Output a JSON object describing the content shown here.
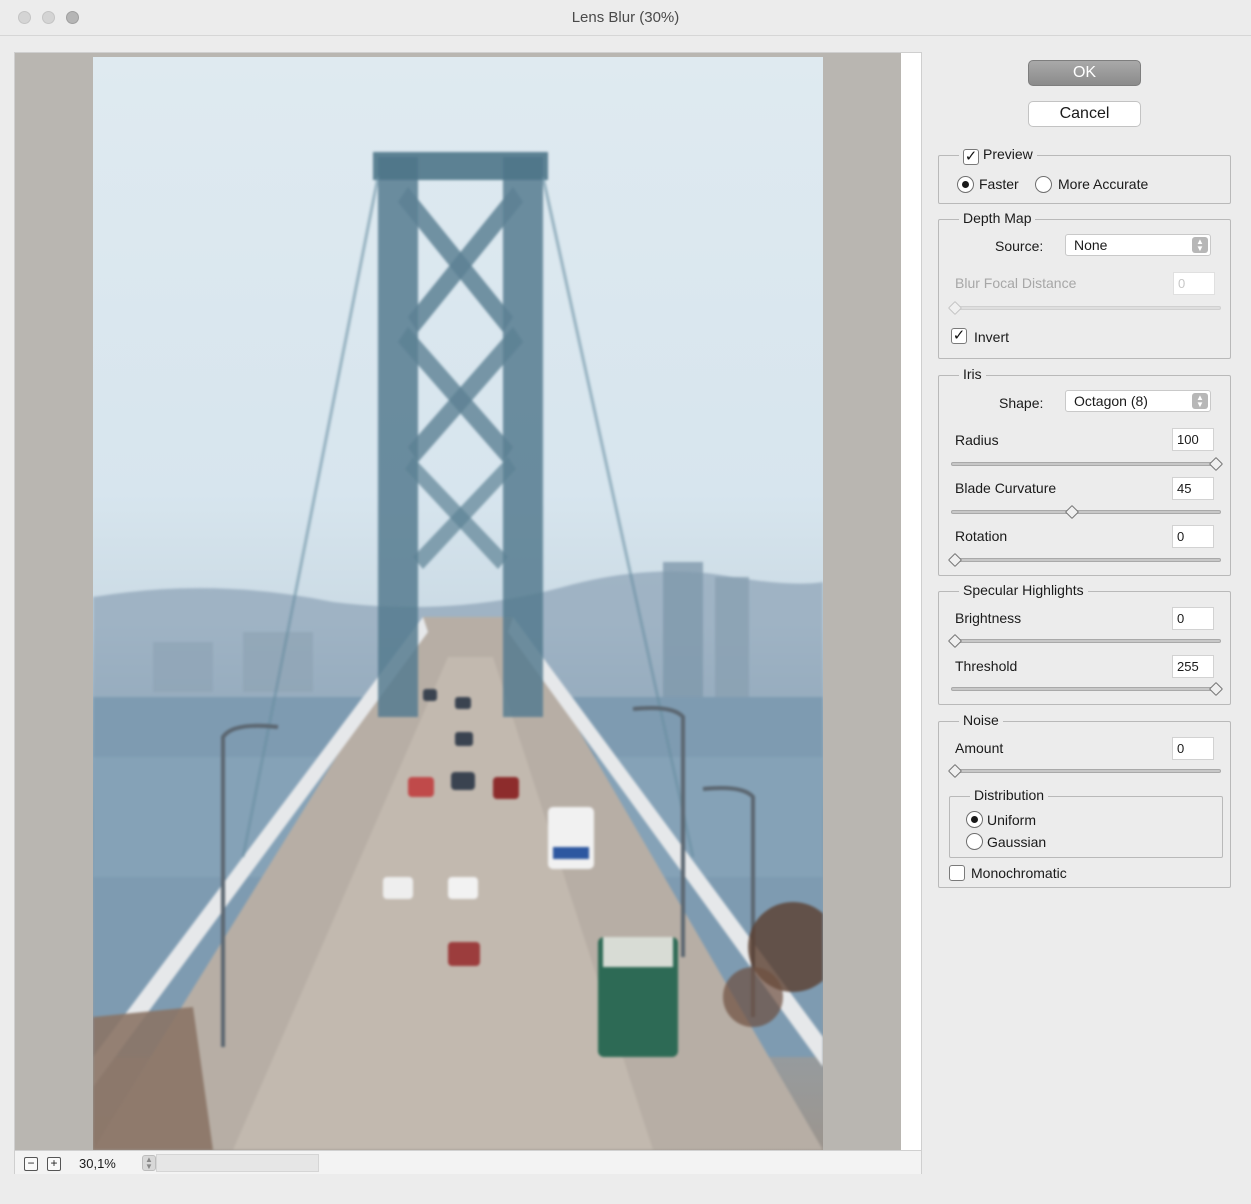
{
  "window": {
    "title": "Lens Blur (30%)"
  },
  "preview": {
    "zoom_value": "30,1%",
    "zoom_out_symbol": "−",
    "zoom_in_symbol": "+"
  },
  "buttons": {
    "ok": "OK",
    "cancel": "Cancel"
  },
  "preview_group": {
    "label": "Preview",
    "checked": true,
    "options": [
      {
        "label": "Faster",
        "selected": true
      },
      {
        "label": "More Accurate",
        "selected": false
      }
    ]
  },
  "depth_map": {
    "legend": "Depth Map",
    "source_label": "Source:",
    "source_value": "None",
    "focal_label": "Blur Focal Distance",
    "focal_value": "0",
    "invert_label": "Invert",
    "invert_checked": true
  },
  "iris": {
    "legend": "Iris",
    "shape_label": "Shape:",
    "shape_value": "Octagon (8)",
    "radius_label": "Radius",
    "radius_value": "100",
    "radius_fraction": 1.0,
    "curvature_label": "Blade Curvature",
    "curvature_value": "45",
    "curvature_fraction": 0.45,
    "rotation_label": "Rotation",
    "rotation_value": "0",
    "rotation_fraction": 0.0
  },
  "specular": {
    "legend": "Specular Highlights",
    "brightness_label": "Brightness",
    "brightness_value": "0",
    "brightness_fraction": 0.0,
    "threshold_label": "Threshold",
    "threshold_value": "255",
    "threshold_fraction": 1.0
  },
  "noise": {
    "legend": "Noise",
    "amount_label": "Amount",
    "amount_value": "0",
    "amount_fraction": 0.0,
    "distribution_legend": "Distribution",
    "options": [
      {
        "label": "Uniform",
        "selected": true
      },
      {
        "label": "Gaussian",
        "selected": false
      }
    ],
    "monochromatic_label": "Monochromatic",
    "monochromatic_checked": false
  }
}
